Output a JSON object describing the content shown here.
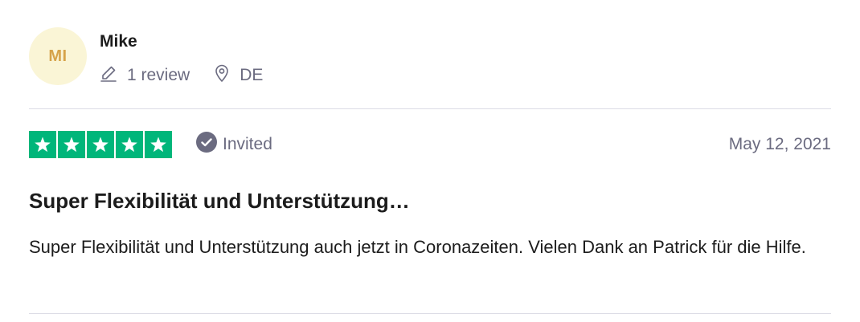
{
  "reviewer": {
    "initials": "MI",
    "name": "Mike",
    "review_count": "1 review",
    "country": "DE"
  },
  "review": {
    "rating": 5,
    "max_rating": 5,
    "status": "Invited",
    "date": "May 12, 2021",
    "title": "Super Flexibilität und Unterstützung…",
    "body": "Super Flexibilität und Unterstützung auch jetzt in Coronazeiten. Vielen Dank an Patrick für die Hilfe."
  },
  "colors": {
    "star_green": "#00b67a",
    "avatar_bg": "#faf5d6",
    "avatar_text": "#d6a34a",
    "muted_text": "#6b6b80"
  },
  "icons": {
    "review_count": "pencil-icon",
    "country": "location-pin-icon",
    "status": "check-circle-icon",
    "star": "star-icon"
  }
}
